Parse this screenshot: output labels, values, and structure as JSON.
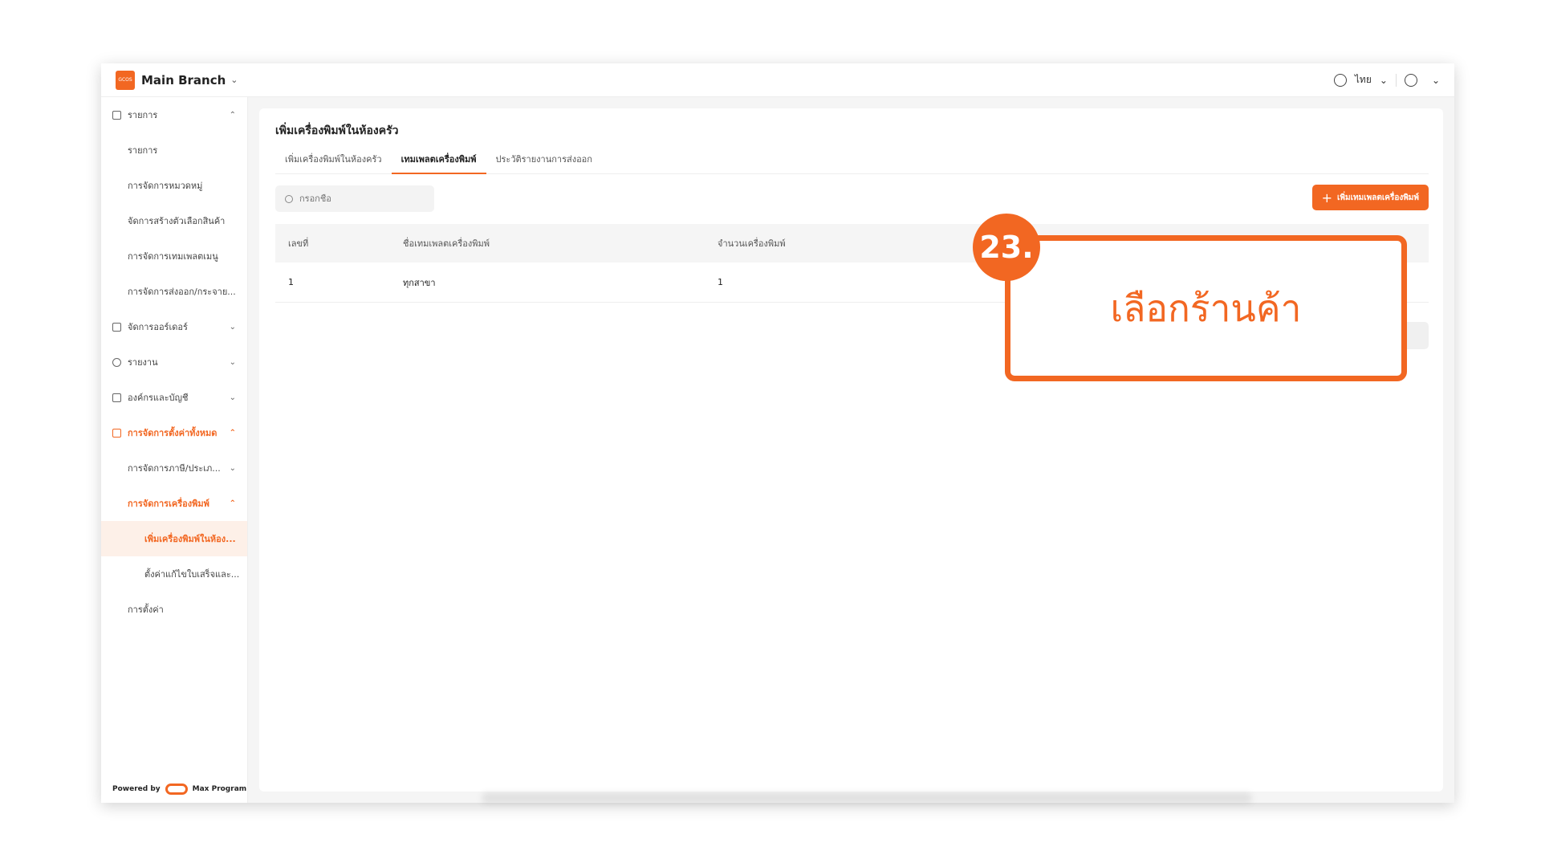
{
  "topbar": {
    "logo_text": "GCOS",
    "branch": "Main Branch",
    "language": "ไทย"
  },
  "sidebar": {
    "items": [
      {
        "label": "รายการ"
      },
      {
        "label": "รายการ"
      },
      {
        "label": "การจัดการหมวดหมู่"
      },
      {
        "label": "จัดการสร้างตัวเลือกสินค้า"
      },
      {
        "label": "การจัดการเทมเพลตเมนู"
      },
      {
        "label": "การจัดการส่งออก/กระจาย..."
      },
      {
        "label": "จัดการออร์เดอร์"
      },
      {
        "label": "รายงาน"
      },
      {
        "label": "องค์กรและบัญชี"
      },
      {
        "label": "การจัดการตั้งค่าทั้งหมด"
      },
      {
        "label": "การจัดการภาษี/ประเภ..."
      },
      {
        "label": "การจัดการเครื่องพิมพ์"
      },
      {
        "label": "เพิ่มเครื่องพิมพ์ในห้อง..."
      },
      {
        "label": "ตั้งค่าแก้ไขใบเสร็จและ..."
      },
      {
        "label": "การตั้งค่า"
      }
    ],
    "powered_by": "Powered by",
    "powered_brand": "Max Program"
  },
  "main": {
    "title": "เพิ่มเครื่องพิมพ์ในห้องครัว",
    "tabs": [
      {
        "label": "เพิ่มเครื่องพิมพ์ในห้องครัว"
      },
      {
        "label": "เทมเพลตเครื่องพิมพ์"
      },
      {
        "label": "ประวัติรายงานการส่งออก"
      }
    ],
    "search_placeholder": "กรอกชื่อ",
    "add_button": "เพิ่มเทมเพลตเครื่องพิมพ์",
    "table": {
      "headers": [
        "เลขที่",
        "ชื่อเทมเพลตเครื่องพิมพ์",
        "จำนวนเครื่องพิมพ์"
      ],
      "rows": [
        [
          "1",
          "ทุกสาขา",
          "1"
        ]
      ]
    }
  },
  "callout": {
    "step": "23.",
    "text": "เลือกร้านค้า"
  },
  "colors": {
    "accent": "#f26722"
  }
}
